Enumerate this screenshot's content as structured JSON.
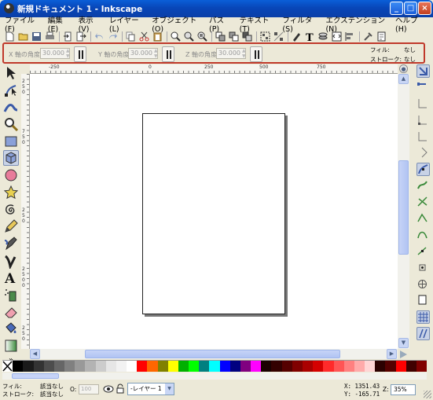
{
  "window": {
    "title": "新規ドキュメント 1 - Inkscape",
    "buttons": {
      "minimize": "_",
      "maximize": "□",
      "close": "×"
    }
  },
  "menu": {
    "items": [
      "ファイル(F)",
      "編集(E)",
      "表示(V)",
      "レイヤー(L)",
      "オブジェクト(O)",
      "パス(P)",
      "テキスト(T)",
      "フィルタ(S)",
      "エクステンション(N)",
      "ヘルプ(H)"
    ]
  },
  "toolcontrols": {
    "x_angle_label": "X 軸の角度:",
    "x_angle_value": "30.000",
    "y_angle_label": "Y 軸の角度:",
    "y_angle_value": "30.000",
    "z_angle_label": "Z 軸の角度:",
    "z_angle_value": "30.000",
    "fill_label": "フィル:",
    "fill_value": "なし",
    "stroke_label": "ストローク:",
    "stroke_value": "なし"
  },
  "rulers": {
    "h_ticks": [
      "-250",
      "0",
      "250",
      "500",
      "750"
    ],
    "v_ticks": [
      "2",
      "5",
      "0",
      "7",
      "5",
      "0",
      "2",
      "5",
      "0",
      "2",
      "5",
      "0",
      "0",
      "2",
      "5",
      "0"
    ]
  },
  "palette": {
    "colors": [
      "#000000",
      "#1a1a1a",
      "#333333",
      "#4d4d4d",
      "#666666",
      "#808080",
      "#999999",
      "#b3b3b3",
      "#cccccc",
      "#e6e6e6",
      "#f2f2f2",
      "#ffffff",
      "#ff0000",
      "#ff6600",
      "#808000",
      "#ffff00",
      "#00b000",
      "#00ff00",
      "#008080",
      "#00ffff",
      "#0000ff",
      "#000080",
      "#800080",
      "#ff00ff",
      "#1a0000",
      "#330000",
      "#550000",
      "#800000",
      "#aa0000",
      "#d40000",
      "#ff2a2a",
      "#ff5555",
      "#ff8080",
      "#ffaaaa",
      "#ffd5d5",
      "#2b0000",
      "#550000",
      "#ff0000",
      "#400000",
      "#800000"
    ]
  },
  "status": {
    "fill_label": "フィル:",
    "fill_value": "該当なし",
    "stroke_label": "ストローク:",
    "stroke_value": "該当なし",
    "opacity_label": "O:",
    "opacity_value": "100",
    "layer": "-レイヤー 1",
    "x_coord": "X: 1351.43",
    "y_coord": "Y: -165.71",
    "zoom_label": "Z:",
    "zoom_value": "35%"
  }
}
